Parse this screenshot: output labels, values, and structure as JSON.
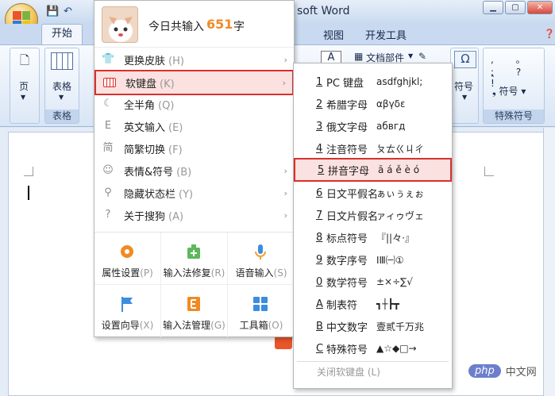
{
  "word": {
    "title_partial": "soft Word",
    "tabs": {
      "home": "开始",
      "view": "视图",
      "dev": "开发工具"
    },
    "ribbon": {
      "page_btn": "页",
      "table_btn": "表格",
      "table_group": "表格",
      "docparts": "文档部件",
      "symbol_num": "符号",
      "symbol_btn": "符号",
      "special_group": "特殊符号"
    }
  },
  "ime": {
    "head_text": "今日共输入",
    "count": "651",
    "unit": "字",
    "menu": [
      {
        "label": "更换皮肤",
        "key": "(H)",
        "icon": "shirt-icon",
        "arrow": true
      },
      {
        "label": "软键盘",
        "key": "(K)",
        "icon": "keyboard-icon",
        "arrow": true
      },
      {
        "label": "全半角",
        "key": "(Q)",
        "icon": "moon-icon",
        "arrow": false
      },
      {
        "label": "英文输入",
        "key": "(E)",
        "icon": "english-icon",
        "arrow": false
      },
      {
        "label": "简繁切换",
        "key": "(F)",
        "icon": "simplified-icon",
        "arrow": false
      },
      {
        "label": "表情&符号",
        "key": "(B)",
        "icon": "smiley-icon",
        "arrow": true
      },
      {
        "label": "隐藏状态栏",
        "key": "(Y)",
        "icon": "hide-icon",
        "arrow": true
      },
      {
        "label": "关于搜狗",
        "key": "(A)",
        "icon": "help-icon",
        "arrow": true
      }
    ],
    "tiles": [
      {
        "label": "属性设置",
        "key": "(P)",
        "icon": "settings-gear-icon"
      },
      {
        "label": "输入法修复",
        "key": "(R)",
        "icon": "repair-icon"
      },
      {
        "label": "语音输入",
        "key": "(S)",
        "icon": "microphone-icon"
      },
      {
        "label": "设置向导",
        "key": "(X)",
        "icon": "flag-icon"
      },
      {
        "label": "输入法管理",
        "key": "(G)",
        "icon": "manage-icon"
      },
      {
        "label": "工具箱",
        "key": "(O)",
        "icon": "toolbox-icon"
      }
    ]
  },
  "softkb": {
    "items": [
      {
        "num": "1",
        "name": "PC 键盘",
        "sample": "asdfghjkl;"
      },
      {
        "num": "2",
        "name": "希腊字母",
        "sample": "αβγδε"
      },
      {
        "num": "3",
        "name": "俄文字母",
        "sample": "абвгд"
      },
      {
        "num": "4",
        "name": "注音符号",
        "sample": "ㄆㄊㄍㄐㄔ"
      },
      {
        "num": "5",
        "name": "拼音字母",
        "sample": "ā á ě è ó"
      },
      {
        "num": "6",
        "name": "日文平假名",
        "sample": "ぁぃぅぇぉ"
      },
      {
        "num": "7",
        "name": "日文片假名",
        "sample": "ァィゥヴェ"
      },
      {
        "num": "8",
        "name": "标点符号",
        "sample": "『||々·』"
      },
      {
        "num": "9",
        "name": "数字序号",
        "sample": "ⅠⅢ㈠①"
      },
      {
        "num": "0",
        "name": "数学符号",
        "sample": "±×÷∑√"
      },
      {
        "num": "A",
        "name": "制表符",
        "sample": "┓┼┣┳"
      },
      {
        "num": "B",
        "name": "中文数字",
        "sample": "壹贰千万兆"
      },
      {
        "num": "C",
        "name": "特殊符号",
        "sample": "▲☆◆□→"
      }
    ],
    "close": "关闭软键盘",
    "close_key": "(L)"
  },
  "watermark": {
    "logo": "php",
    "text": "中文网"
  }
}
